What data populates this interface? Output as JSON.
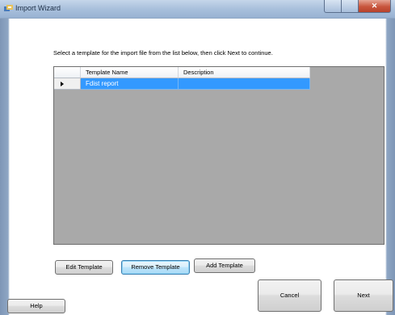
{
  "window": {
    "title": "Import Wizard",
    "close_glyph": "✕"
  },
  "instruction": "Select a template for the import file from the list below, then click Next to continue.",
  "grid": {
    "columns": [
      "",
      "Template Name",
      "Description"
    ],
    "rows": [
      {
        "indicator": "current-row-arrow-icon",
        "template_name": "Fdist report",
        "description": ""
      }
    ],
    "selected_row": 0
  },
  "buttons": {
    "edit_template": "Edit Template",
    "remove_template": "Remove Template",
    "add_template": "Add Template",
    "cancel": "Cancel",
    "next": "Next",
    "help": "Help"
  },
  "colors": {
    "grid_background": "#a9a9a9",
    "selection": "#3399ff",
    "titlebar": "#a9c0dc",
    "close_button": "#c8553d"
  }
}
